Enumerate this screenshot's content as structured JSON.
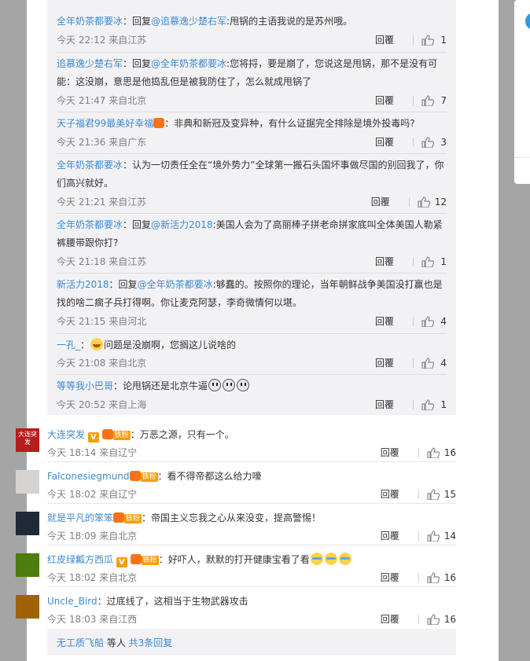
{
  "replies": [
    {
      "name": "全年奶茶都要冰",
      "prefix": "：回复",
      "mention": "@追慕逸少楚右军",
      "text": ":甩锅的主语我说的是苏州哦。",
      "meta": "今天 22:12 来自江苏",
      "reply": "回覆",
      "likes": "1"
    },
    {
      "name": "追慕逸少楚右军",
      "prefix": "：回复",
      "mention": "@全年奶茶都要冰",
      "text": ":您将捋，要是崩了，您说这是甩锅，那不是没有可",
      "line2": "能：这没崩，意思是他捣乱但是被我防住了，怎么就成甩锅了",
      "meta": "今天 21:47 来自北京",
      "reply": "回覆",
      "likes": "7"
    },
    {
      "name": "天子福君99最美好幸福",
      "text": "：非典和新冠及变异种，有什么证据完全排除是境外投毒吗?",
      "meta": "今天 21:36 来自广东",
      "reply": "回覆",
      "likes": "3"
    },
    {
      "name": "全年奶茶都要冰",
      "text": "：认为一切责任全在“境外势力”全球第一搬石头国坏事做尽国的别回我了，你",
      "line2": "们高兴就好。",
      "meta": "今天 21:21 来自江苏",
      "reply": "回覆",
      "likes": "12"
    },
    {
      "name": "全年奶茶都要冰",
      "prefix": "：回复",
      "mention": "@新活力2018",
      "text": ":美国人会为了高丽棒子拼老命拼家底叫全体美国人勒紧",
      "line2": "裤腰带跟你打?",
      "meta": "今天 21:18 来自江苏",
      "reply": "回覆",
      "likes": "1"
    },
    {
      "name": "新活力2018",
      "prefix": "：回复",
      "mention": "@全年奶茶都要冰",
      "text": ":够蠢的。按照你的理论，当年朝鲜战争美国没打赢也是",
      "line2": "找的啥二瘸子兵打得啊。你让麦克阿瑟，李奇微情何以堪。",
      "meta": "今天 21:15 来自河北",
      "reply": "回覆",
      "likes": "4"
    },
    {
      "name": "一孔_",
      "text": "问题是没崩啊，您搁这儿说啥的",
      "meta": "今天 21:08 来自北京",
      "reply": "回覆",
      "likes": "4"
    },
    {
      "name": "等等我小巴哥",
      "text": "：论甩锅还是北京牛逼",
      "meta": "今天 20:52 来自上海",
      "reply": "回覆",
      "likes": "1"
    }
  ],
  "comments": [
    {
      "name": "大连突发",
      "text": "：万恶之源，只有一个。",
      "meta": "今天 18:14 来自辽宁",
      "reply": "回覆",
      "likes": "16",
      "badge": "铁粉",
      "avatar_text": "大连突发"
    },
    {
      "name": "Falconesiegmund",
      "text": "：看不得帝都这么给力嚎",
      "meta": "今天 18:02 来自辽宁",
      "reply": "回覆",
      "likes": "15",
      "badge": "铁粉"
    },
    {
      "name": "就是平凡的笨笨",
      "text": "：帝国主义忘我之心从来没变，提高警惕！",
      "meta": "今天 18:09 来自北京",
      "reply": "回覆",
      "likes": "14",
      "badge": "铁粉"
    },
    {
      "name": "红皮绿瓤方西瓜",
      "text": "：好吓人，默默的打开健康宝看了看",
      "meta": "今天 18:02 来自北京",
      "reply": "回覆",
      "likes": "16",
      "badge": "铁粉"
    },
    {
      "name": "Uncle_Bird",
      "text": "：过底线了，这相当于生物武器攻击",
      "meta": "今天 18:03 来自江西",
      "reply": "回覆",
      "likes": "16"
    }
  ],
  "footer": {
    "name": "无工质飞船",
    "mid": " 等人 ",
    "link": "共3条回复"
  },
  "colors": {
    "name": "#3e8ace",
    "meta": "#808080",
    "panel": "#f2f2f5",
    "backdrop": "#a5a5a5"
  }
}
